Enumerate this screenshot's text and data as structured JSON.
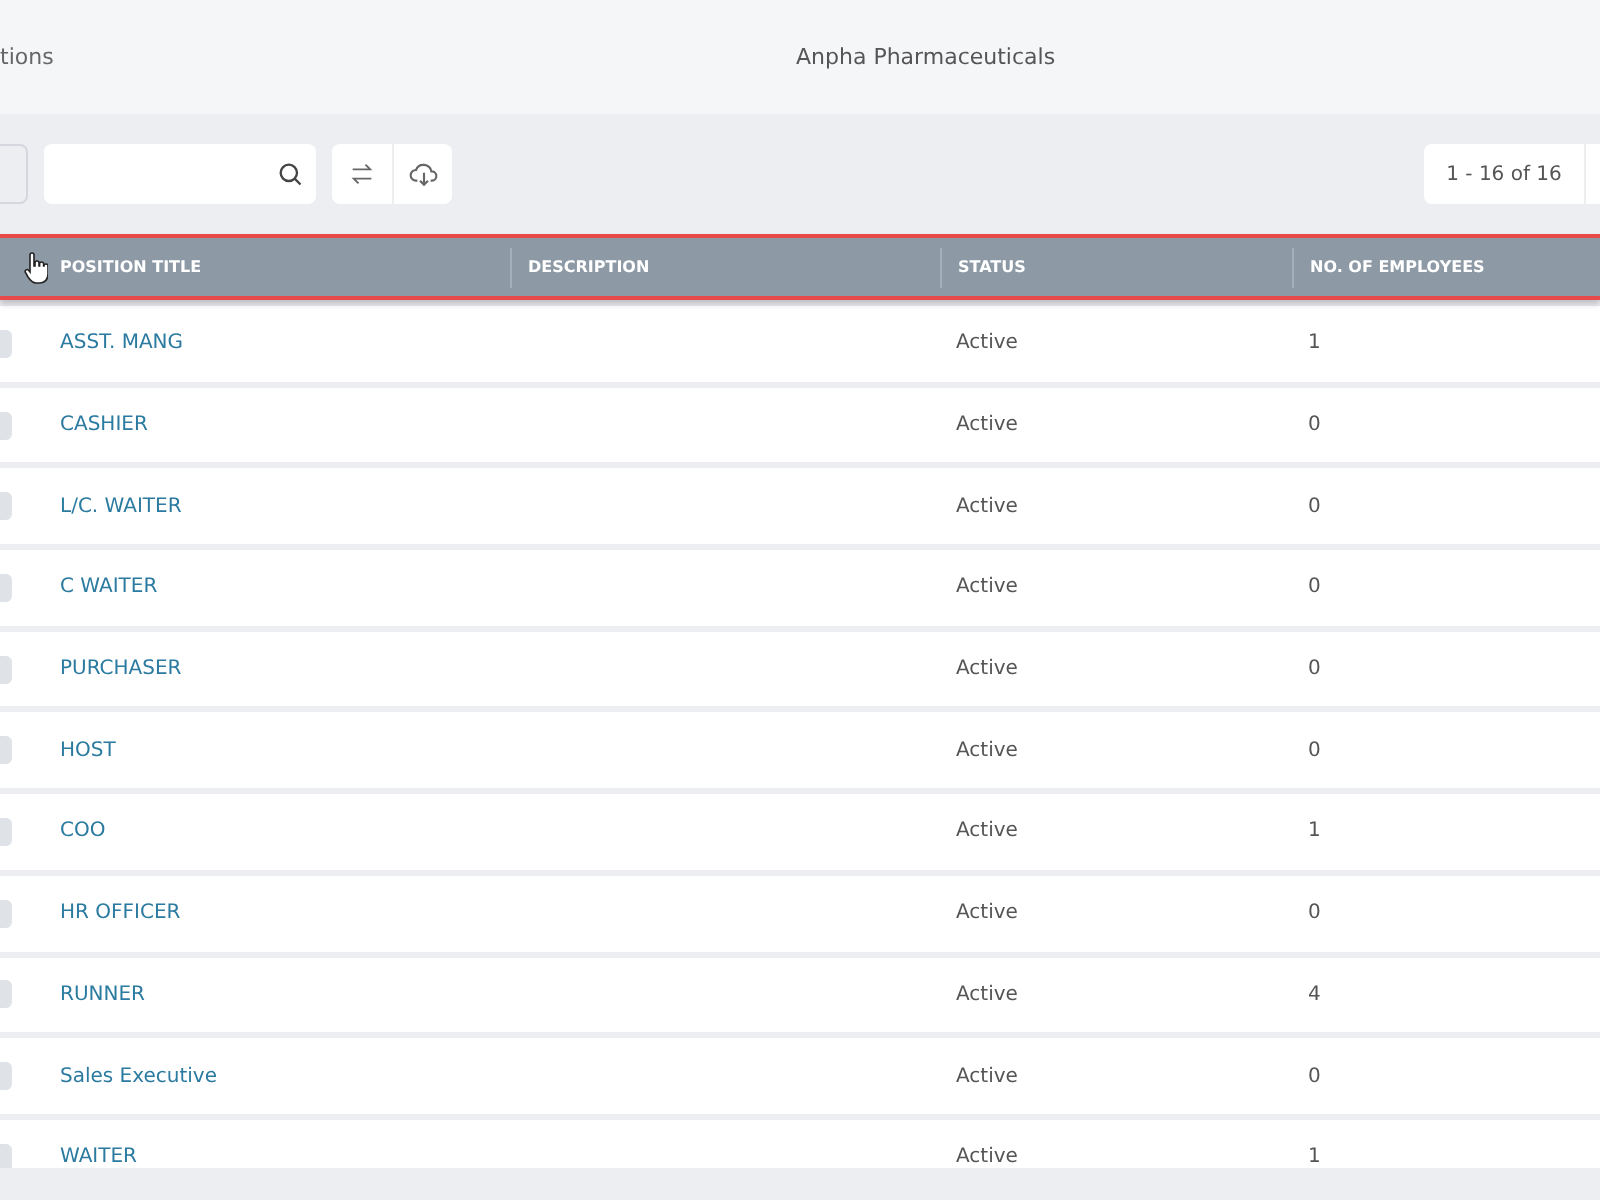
{
  "header": {
    "breadcrumb": "tions",
    "company": "Anpha Pharmaceuticals"
  },
  "toolbar": {
    "pagination": "1 - 16 of 16"
  },
  "table": {
    "columns": [
      "POSITION TITLE",
      "DESCRIPTION",
      "STATUS",
      "NO. OF EMPLOYEES"
    ],
    "rows": [
      {
        "title": "ASST. MANG",
        "status": "Active",
        "employees": "1",
        "checked": false
      },
      {
        "title": "CASHIER",
        "status": "Active",
        "employees": "0",
        "checked": false
      },
      {
        "title": "L/C. WAITER",
        "status": "Active",
        "employees": "0",
        "checked": false
      },
      {
        "title": "C WAITER",
        "status": "Active",
        "employees": "0",
        "checked": false
      },
      {
        "title": "PURCHASER",
        "status": "Active",
        "employees": "0",
        "checked": false
      },
      {
        "title": "HOST",
        "status": "Active",
        "employees": "0",
        "checked": false
      },
      {
        "title": "COO",
        "status": "Active",
        "employees": "1",
        "checked": false
      },
      {
        "title": "HR OFFICER",
        "status": "Active",
        "employees": "0",
        "checked": false
      },
      {
        "title": "RUNNER",
        "status": "Active",
        "employees": "4",
        "checked": false
      },
      {
        "title": "Sales Executive",
        "status": "Active",
        "employees": "0",
        "checked": false
      },
      {
        "title": "WAITER",
        "status": "Active",
        "employees": "1",
        "checked": false
      }
    ]
  }
}
